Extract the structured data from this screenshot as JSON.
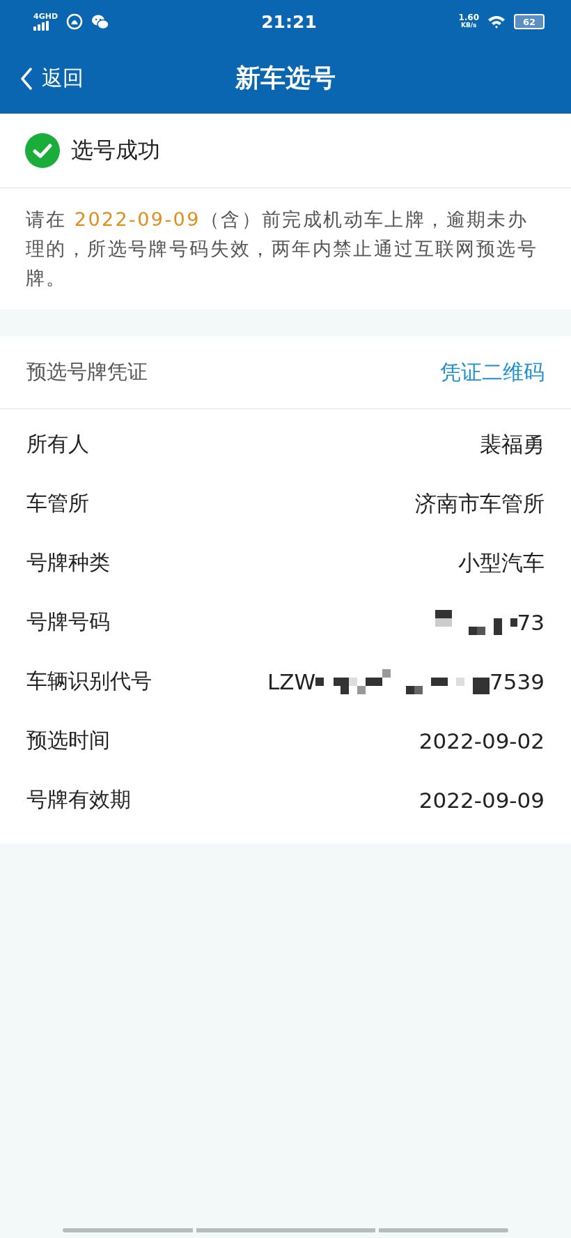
{
  "status_bar": {
    "network": "4GHD",
    "time": "21:21",
    "speed": "1.60",
    "speed_unit": "KB/s",
    "battery": "62"
  },
  "nav": {
    "back": "返回",
    "title": "新车选号"
  },
  "result": {
    "text": "选号成功"
  },
  "notice": {
    "before": "请在 ",
    "highlight": "2022-09-09",
    "after": "（含）前完成机动车上牌，逾期未办理的，所选号牌号码失效，两年内禁止通过互联网预选号牌。"
  },
  "voucher": {
    "title": "预选号牌凭证",
    "link": "凭证二维码"
  },
  "rows": [
    {
      "label": "所有人",
      "kind": "text",
      "value": "裴福勇"
    },
    {
      "label": "车管所",
      "kind": "text",
      "value": "济南市车管所"
    },
    {
      "label": "号牌种类",
      "kind": "text",
      "value": "小型汽车"
    },
    {
      "label": "号牌号码",
      "kind": "masked",
      "prefix": "",
      "suffix": "73"
    },
    {
      "label": "车辆识别代号",
      "kind": "masked",
      "prefix": "LZW",
      "suffix": "7539"
    },
    {
      "label": "预选时间",
      "kind": "text",
      "value": "2022-09-02"
    },
    {
      "label": "号牌有效期",
      "kind": "text",
      "value": "2022-09-09"
    }
  ]
}
